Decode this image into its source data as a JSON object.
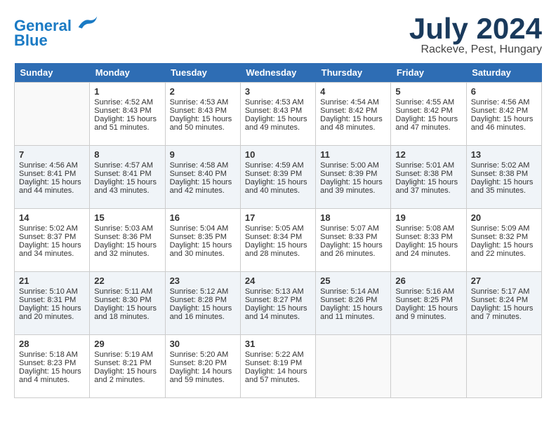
{
  "header": {
    "logo_line1": "General",
    "logo_line2": "Blue",
    "month_title": "July 2024",
    "location": "Rackeve, Pest, Hungary"
  },
  "days_of_week": [
    "Sunday",
    "Monday",
    "Tuesday",
    "Wednesday",
    "Thursday",
    "Friday",
    "Saturday"
  ],
  "weeks": [
    [
      {
        "day": "",
        "sunrise": "",
        "sunset": "",
        "daylight": ""
      },
      {
        "day": "1",
        "sunrise": "Sunrise: 4:52 AM",
        "sunset": "Sunset: 8:43 PM",
        "daylight": "Daylight: 15 hours and 51 minutes."
      },
      {
        "day": "2",
        "sunrise": "Sunrise: 4:53 AM",
        "sunset": "Sunset: 8:43 PM",
        "daylight": "Daylight: 15 hours and 50 minutes."
      },
      {
        "day": "3",
        "sunrise": "Sunrise: 4:53 AM",
        "sunset": "Sunset: 8:43 PM",
        "daylight": "Daylight: 15 hours and 49 minutes."
      },
      {
        "day": "4",
        "sunrise": "Sunrise: 4:54 AM",
        "sunset": "Sunset: 8:42 PM",
        "daylight": "Daylight: 15 hours and 48 minutes."
      },
      {
        "day": "5",
        "sunrise": "Sunrise: 4:55 AM",
        "sunset": "Sunset: 8:42 PM",
        "daylight": "Daylight: 15 hours and 47 minutes."
      },
      {
        "day": "6",
        "sunrise": "Sunrise: 4:56 AM",
        "sunset": "Sunset: 8:42 PM",
        "daylight": "Daylight: 15 hours and 46 minutes."
      }
    ],
    [
      {
        "day": "7",
        "sunrise": "Sunrise: 4:56 AM",
        "sunset": "Sunset: 8:41 PM",
        "daylight": "Daylight: 15 hours and 44 minutes."
      },
      {
        "day": "8",
        "sunrise": "Sunrise: 4:57 AM",
        "sunset": "Sunset: 8:41 PM",
        "daylight": "Daylight: 15 hours and 43 minutes."
      },
      {
        "day": "9",
        "sunrise": "Sunrise: 4:58 AM",
        "sunset": "Sunset: 8:40 PM",
        "daylight": "Daylight: 15 hours and 42 minutes."
      },
      {
        "day": "10",
        "sunrise": "Sunrise: 4:59 AM",
        "sunset": "Sunset: 8:39 PM",
        "daylight": "Daylight: 15 hours and 40 minutes."
      },
      {
        "day": "11",
        "sunrise": "Sunrise: 5:00 AM",
        "sunset": "Sunset: 8:39 PM",
        "daylight": "Daylight: 15 hours and 39 minutes."
      },
      {
        "day": "12",
        "sunrise": "Sunrise: 5:01 AM",
        "sunset": "Sunset: 8:38 PM",
        "daylight": "Daylight: 15 hours and 37 minutes."
      },
      {
        "day": "13",
        "sunrise": "Sunrise: 5:02 AM",
        "sunset": "Sunset: 8:38 PM",
        "daylight": "Daylight: 15 hours and 35 minutes."
      }
    ],
    [
      {
        "day": "14",
        "sunrise": "Sunrise: 5:02 AM",
        "sunset": "Sunset: 8:37 PM",
        "daylight": "Daylight: 15 hours and 34 minutes."
      },
      {
        "day": "15",
        "sunrise": "Sunrise: 5:03 AM",
        "sunset": "Sunset: 8:36 PM",
        "daylight": "Daylight: 15 hours and 32 minutes."
      },
      {
        "day": "16",
        "sunrise": "Sunrise: 5:04 AM",
        "sunset": "Sunset: 8:35 PM",
        "daylight": "Daylight: 15 hours and 30 minutes."
      },
      {
        "day": "17",
        "sunrise": "Sunrise: 5:05 AM",
        "sunset": "Sunset: 8:34 PM",
        "daylight": "Daylight: 15 hours and 28 minutes."
      },
      {
        "day": "18",
        "sunrise": "Sunrise: 5:07 AM",
        "sunset": "Sunset: 8:33 PM",
        "daylight": "Daylight: 15 hours and 26 minutes."
      },
      {
        "day": "19",
        "sunrise": "Sunrise: 5:08 AM",
        "sunset": "Sunset: 8:33 PM",
        "daylight": "Daylight: 15 hours and 24 minutes."
      },
      {
        "day": "20",
        "sunrise": "Sunrise: 5:09 AM",
        "sunset": "Sunset: 8:32 PM",
        "daylight": "Daylight: 15 hours and 22 minutes."
      }
    ],
    [
      {
        "day": "21",
        "sunrise": "Sunrise: 5:10 AM",
        "sunset": "Sunset: 8:31 PM",
        "daylight": "Daylight: 15 hours and 20 minutes."
      },
      {
        "day": "22",
        "sunrise": "Sunrise: 5:11 AM",
        "sunset": "Sunset: 8:30 PM",
        "daylight": "Daylight: 15 hours and 18 minutes."
      },
      {
        "day": "23",
        "sunrise": "Sunrise: 5:12 AM",
        "sunset": "Sunset: 8:28 PM",
        "daylight": "Daylight: 15 hours and 16 minutes."
      },
      {
        "day": "24",
        "sunrise": "Sunrise: 5:13 AM",
        "sunset": "Sunset: 8:27 PM",
        "daylight": "Daylight: 15 hours and 14 minutes."
      },
      {
        "day": "25",
        "sunrise": "Sunrise: 5:14 AM",
        "sunset": "Sunset: 8:26 PM",
        "daylight": "Daylight: 15 hours and 11 minutes."
      },
      {
        "day": "26",
        "sunrise": "Sunrise: 5:16 AM",
        "sunset": "Sunset: 8:25 PM",
        "daylight": "Daylight: 15 hours and 9 minutes."
      },
      {
        "day": "27",
        "sunrise": "Sunrise: 5:17 AM",
        "sunset": "Sunset: 8:24 PM",
        "daylight": "Daylight: 15 hours and 7 minutes."
      }
    ],
    [
      {
        "day": "28",
        "sunrise": "Sunrise: 5:18 AM",
        "sunset": "Sunset: 8:23 PM",
        "daylight": "Daylight: 15 hours and 4 minutes."
      },
      {
        "day": "29",
        "sunrise": "Sunrise: 5:19 AM",
        "sunset": "Sunset: 8:21 PM",
        "daylight": "Daylight: 15 hours and 2 minutes."
      },
      {
        "day": "30",
        "sunrise": "Sunrise: 5:20 AM",
        "sunset": "Sunset: 8:20 PM",
        "daylight": "Daylight: 14 hours and 59 minutes."
      },
      {
        "day": "31",
        "sunrise": "Sunrise: 5:22 AM",
        "sunset": "Sunset: 8:19 PM",
        "daylight": "Daylight: 14 hours and 57 minutes."
      },
      {
        "day": "",
        "sunrise": "",
        "sunset": "",
        "daylight": ""
      },
      {
        "day": "",
        "sunrise": "",
        "sunset": "",
        "daylight": ""
      },
      {
        "day": "",
        "sunrise": "",
        "sunset": "",
        "daylight": ""
      }
    ]
  ]
}
